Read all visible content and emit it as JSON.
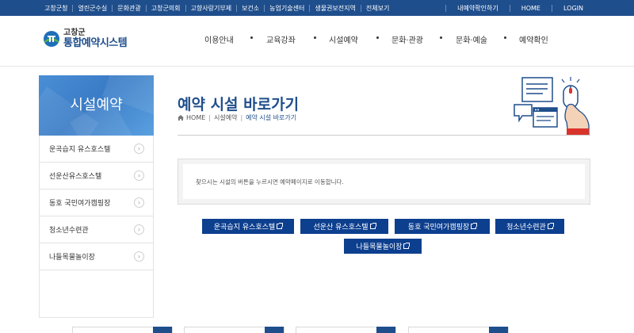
{
  "topbar": {
    "left_links": [
      "고창군청",
      "열린군수실",
      "문화관광",
      "고창군의회",
      "고향사랑기부제",
      "보건소",
      "농업기술센터",
      "생물권보전지역",
      "전체보기"
    ],
    "right_links": [
      "내예약확인하기",
      "HOME",
      "LOGIN"
    ]
  },
  "logo": {
    "line1": "고창군",
    "line2": "통합예약시스템"
  },
  "gnb": [
    "이용안내",
    "교육강좌",
    "시설예약",
    "문화·관광",
    "문화·예술",
    "예약확인"
  ],
  "sidebar": {
    "title": "시설예약",
    "items": [
      "운곡습지 유스호스텔",
      "선운산유스호스텔",
      "동호 국민여가캠핑장",
      "청소년수련관",
      "나들목물놀이장"
    ]
  },
  "content": {
    "title": "예약 시설 바로가기",
    "breadcrumb": {
      "home": "HOME",
      "section": "시설예약",
      "current": "예약 시설 바로가기"
    },
    "notice": "찾으시는 시설의 버튼을 누르시면 예약페이지로 이동합니다.",
    "buttons": [
      "운곡습지 유스호스텔",
      "선운산 유스호스텔",
      "동호 국민여가캠핑장",
      "청소년수련관",
      "나들목물놀이장"
    ]
  },
  "colors": {
    "primary": "#1f4e8c",
    "button": "#0d3f8f",
    "sidebar_title": "#4a8fd6",
    "accent_red": "#d9342b"
  }
}
